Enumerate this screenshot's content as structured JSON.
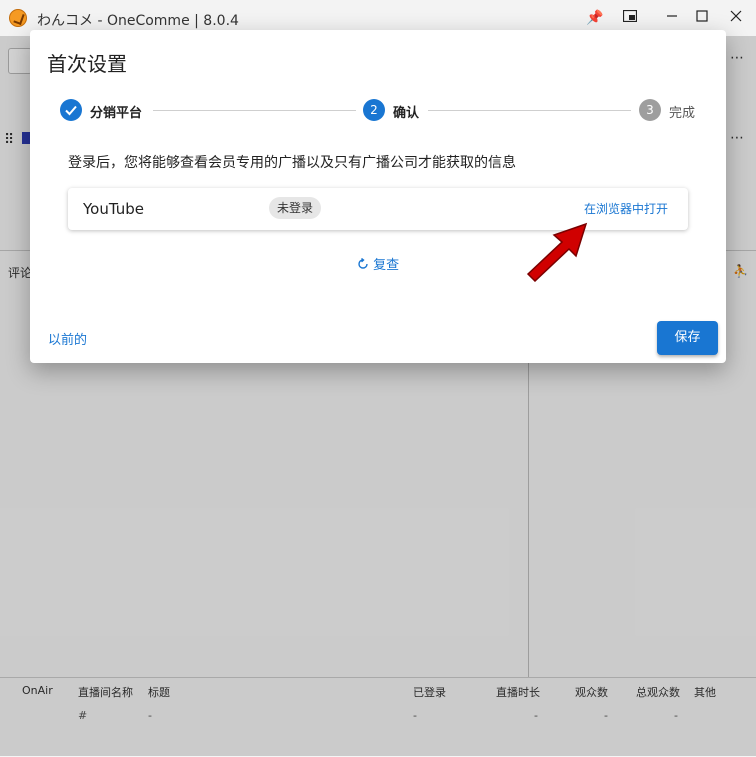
{
  "window": {
    "title": "わんコメ - OneComme | 8.0.4"
  },
  "background": {
    "comment_tab_label": "评论",
    "table_headers": [
      "OnAir",
      "直播间名称",
      "标题",
      "已登录",
      "直播时长",
      "观众数",
      "总观众数",
      "其他"
    ],
    "table_row": [
      "#",
      "-",
      "-",
      "-",
      "-",
      "-"
    ]
  },
  "dialog": {
    "title": "首次设置",
    "steps": [
      {
        "label": "分销平台",
        "state": "completed"
      },
      {
        "number": "2",
        "label": "确认",
        "state": "active"
      },
      {
        "number": "3",
        "label": "完成",
        "state": "pending"
      }
    ],
    "info_text": "登录后，您将能够查看会员专用的广播以及只有广播公司才能获取的信息",
    "platform": {
      "name": "YouTube",
      "status": "未登录",
      "open_link": "在浏览器中打开"
    },
    "recheck_label": "复查",
    "previous_label": "以前的",
    "save_label": "保存"
  },
  "colors": {
    "primary": "#1976d2",
    "step_pending": "#9e9e9e",
    "arrow": "#d00000"
  }
}
